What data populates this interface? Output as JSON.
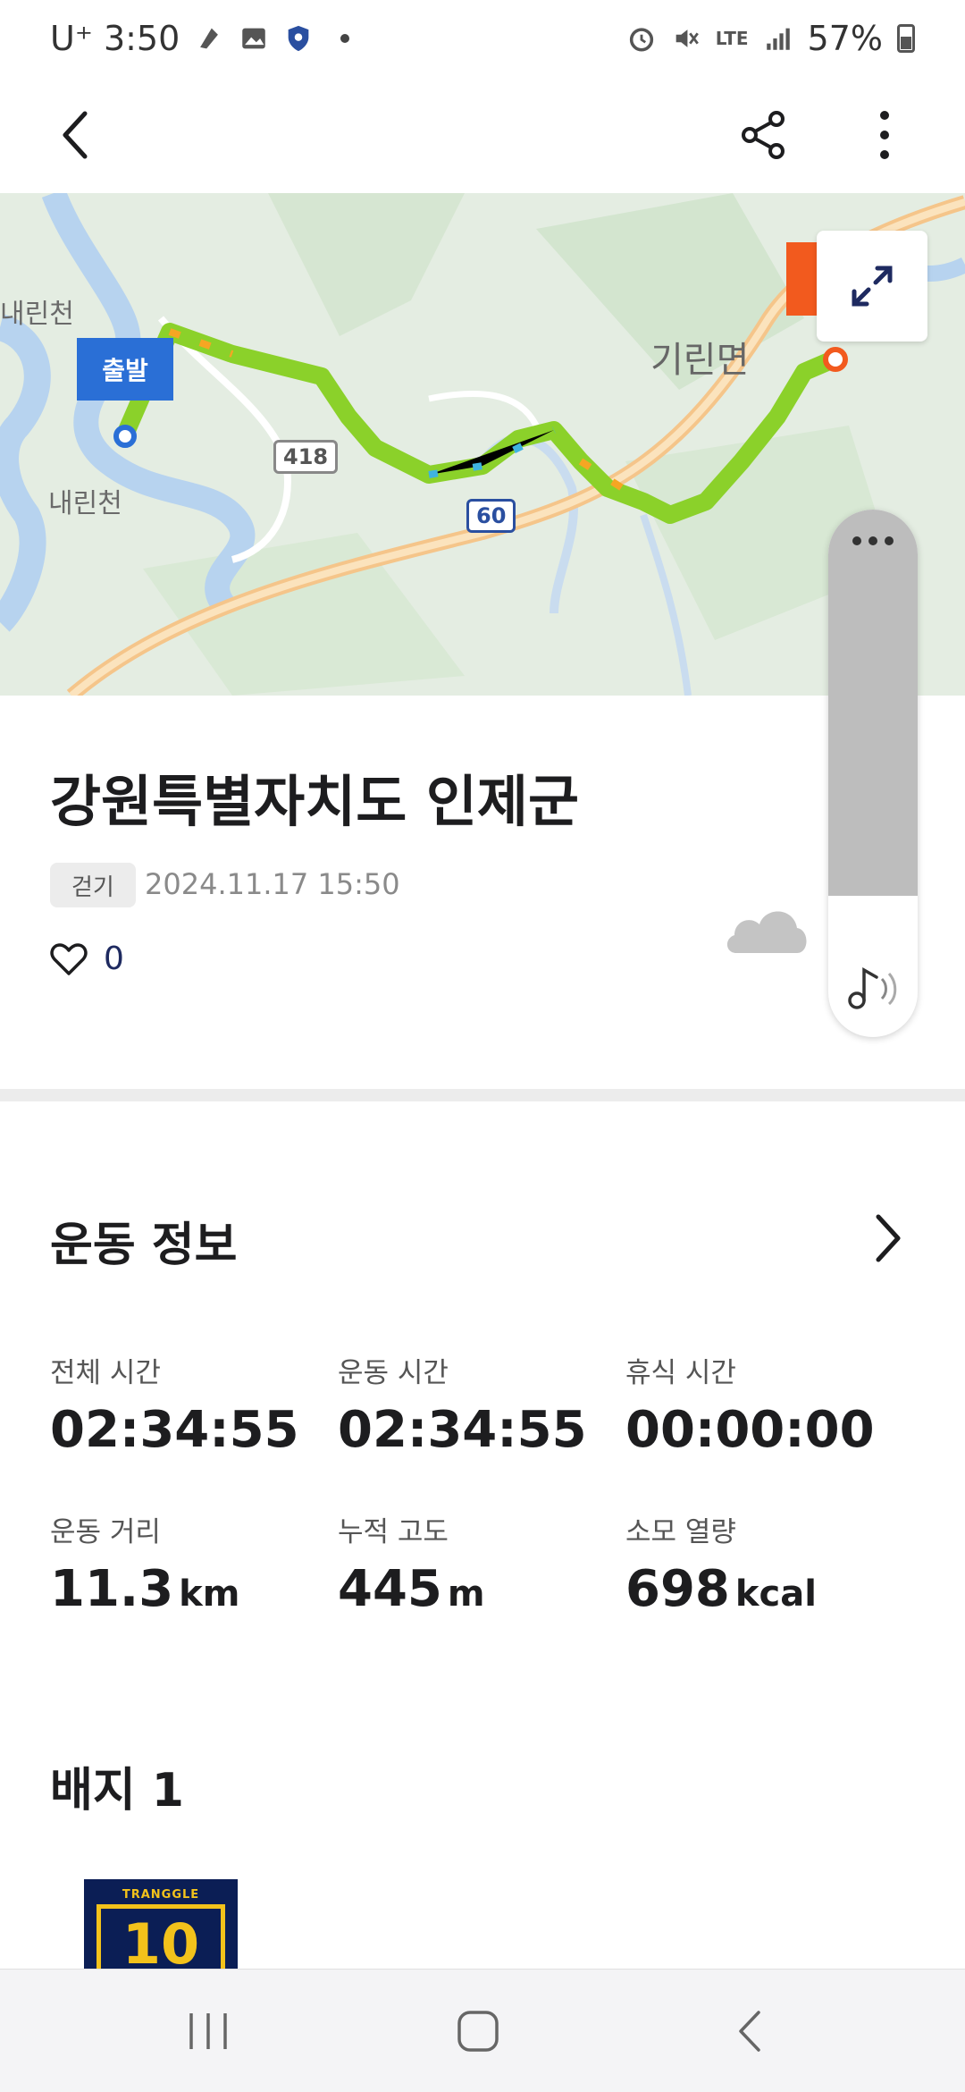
{
  "status_bar": {
    "carrier_time": "U⁺ 3:50",
    "network": "LTE",
    "battery": "57%"
  },
  "app_bar": {
    "back_icon": "chevron-left-icon",
    "share_icon": "share-icon",
    "more_icon": "more-vertical-icon"
  },
  "map": {
    "start_label": "출발",
    "place_labels": [
      "내린천",
      "내린천",
      "기린면"
    ],
    "road_badges": [
      "418",
      "60"
    ],
    "route_color": "#8bd12a"
  },
  "activity": {
    "title": "강원특별자치도 인제군",
    "type_tag": "걷기",
    "datetime": "2024.11.17 15:50",
    "like_count": "0"
  },
  "exercise_info": {
    "title": "운동 정보",
    "stats": [
      {
        "label": "전체 시간",
        "value": "02:34:55",
        "unit": ""
      },
      {
        "label": "운동 시간",
        "value": "02:34:55",
        "unit": ""
      },
      {
        "label": "휴식 시간",
        "value": "00:00:00",
        "unit": ""
      },
      {
        "label": "운동 거리",
        "value": "11.3",
        "unit": "km"
      },
      {
        "label": "누적 고도",
        "value": "445",
        "unit": "m"
      },
      {
        "label": "소모 열량",
        "value": "698",
        "unit": "kcal"
      }
    ]
  },
  "badges": {
    "title": "배지 1",
    "items": [
      {
        "brand": "TRANGGLE",
        "number": "10"
      }
    ]
  },
  "colors": {
    "accent_blue": "#2a6fd6",
    "badge_navy": "#0b1e55",
    "badge_gold": "#f3c21b",
    "end_marker": "#f25a1e"
  }
}
